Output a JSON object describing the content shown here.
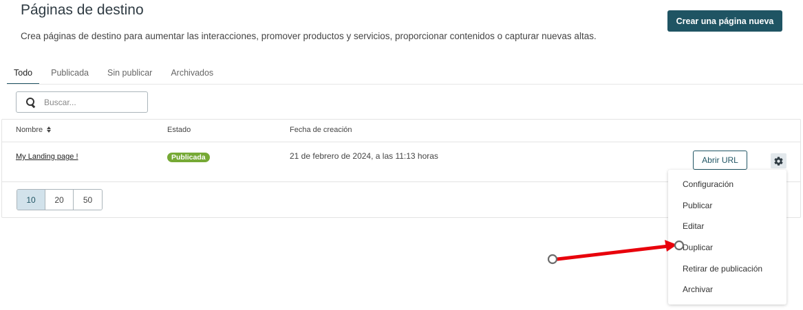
{
  "header": {
    "title": "Páginas de destino",
    "description": "Crea páginas de destino para aumentar las interacciones, promover productos y servicios, proporcionar contenidos o capturar nuevas altas.",
    "create_button": "Crear una página nueva"
  },
  "tabs": [
    {
      "label": "Todo",
      "active": true
    },
    {
      "label": "Publicada",
      "active": false
    },
    {
      "label": "Sin publicar",
      "active": false
    },
    {
      "label": "Archivados",
      "active": false
    }
  ],
  "search": {
    "placeholder": "Buscar...",
    "value": ""
  },
  "table": {
    "columns": [
      "Nombre",
      "Estado",
      "Fecha de creación"
    ],
    "rows": [
      {
        "name": "My Landing page !",
        "status": "Publicada",
        "created": "21 de febrero de 2024, a las 11:13 horas",
        "open_url_label": "Abrir URL"
      }
    ]
  },
  "pagination": {
    "sizes": [
      "10",
      "20",
      "50"
    ],
    "selected": "10"
  },
  "row_menu": {
    "items": [
      "Configuración",
      "Publicar",
      "Editar",
      "Duplicar",
      "Retirar de publicación",
      "Archivar"
    ]
  },
  "colors": {
    "primary": "#1f5463",
    "status_published": "#76a935",
    "annotation_arrow": "#e8000b"
  }
}
